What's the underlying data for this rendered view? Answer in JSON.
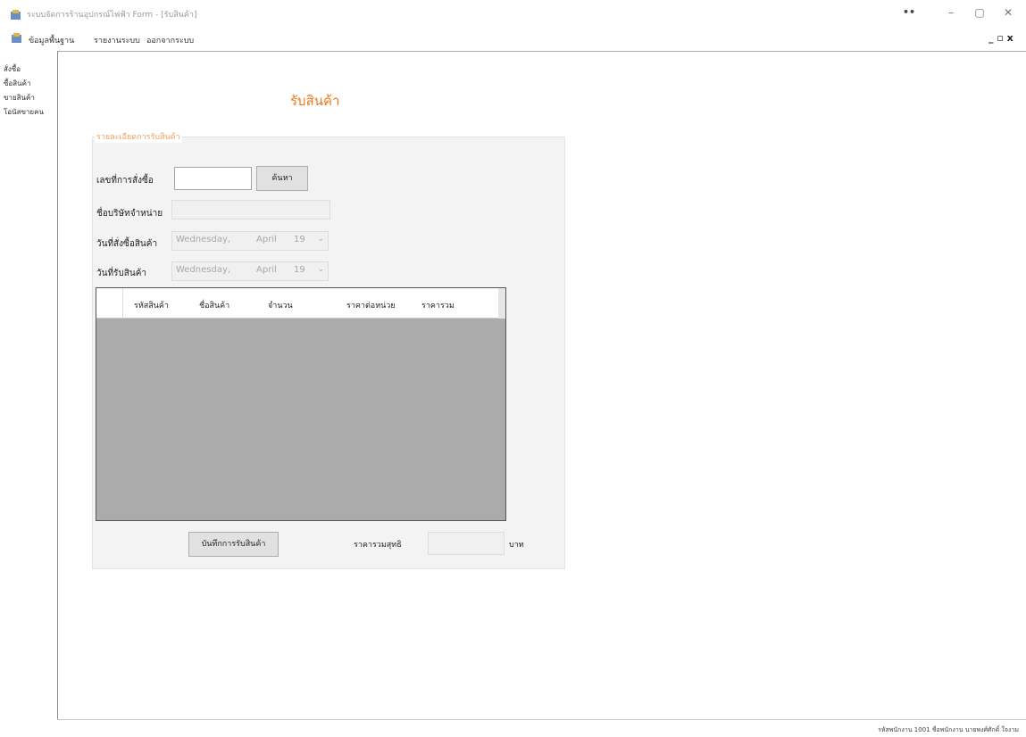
{
  "window": {
    "title": "ระบบจัดการร้านอุปกรณ์ไฟฟ้า Form - [รับสินค้า]",
    "extra_glyph": "••",
    "minimize_glyph": "–",
    "maximize_glyph": "▢",
    "close_glyph": "✕"
  },
  "menu": {
    "items": [
      "ข้อมูลพื้นฐาน",
      "รายงานระบบ",
      "ออกจากระบบ"
    ],
    "mdi_controls": "_ ▫ x"
  },
  "nav": {
    "items": [
      "สั่งซื้อ",
      "ซื้อสินค้า",
      "ขายสินค้า",
      "โอนัสขายคน"
    ]
  },
  "form": {
    "title": "รับสินค้า",
    "group_title": "รายละเอียดการรับสินค้า",
    "po_label": "เลขที่การสั่งซื้อ",
    "po_value": "",
    "search_button": "ค้นหา",
    "supplier_label": "ชื่อบริษัทจำหน่าย",
    "supplier_value": "",
    "order_date_label": "วันที่สั่งซื้อสินค้า",
    "receive_date_label": "วันที่รับสินค้า",
    "order_date": {
      "day": "Wednesday,",
      "month": "April",
      "date": "19"
    },
    "receive_date": {
      "day": "Wednesday,",
      "month": "April",
      "date": "19"
    },
    "grid_columns": [
      "รหัสสินค้า",
      "ชื่อสินค้า",
      "จำนวน",
      "ราคาต่อหน่วย",
      "ราคารวม"
    ],
    "save_button": "บันทึกการรับสินค้า",
    "total_label": "ราคารวมสุทธิ",
    "total_value": "",
    "total_unit": "บาท"
  },
  "status": {
    "text": "รหัสพนักงาน 1001 ชื่อพนักงาน นายพงศ์ศักดิ์ ใจงาม"
  },
  "colors": {
    "title_accent": "#e87b1e",
    "group_title": "#f0a060",
    "grid_background": "#ababab"
  }
}
